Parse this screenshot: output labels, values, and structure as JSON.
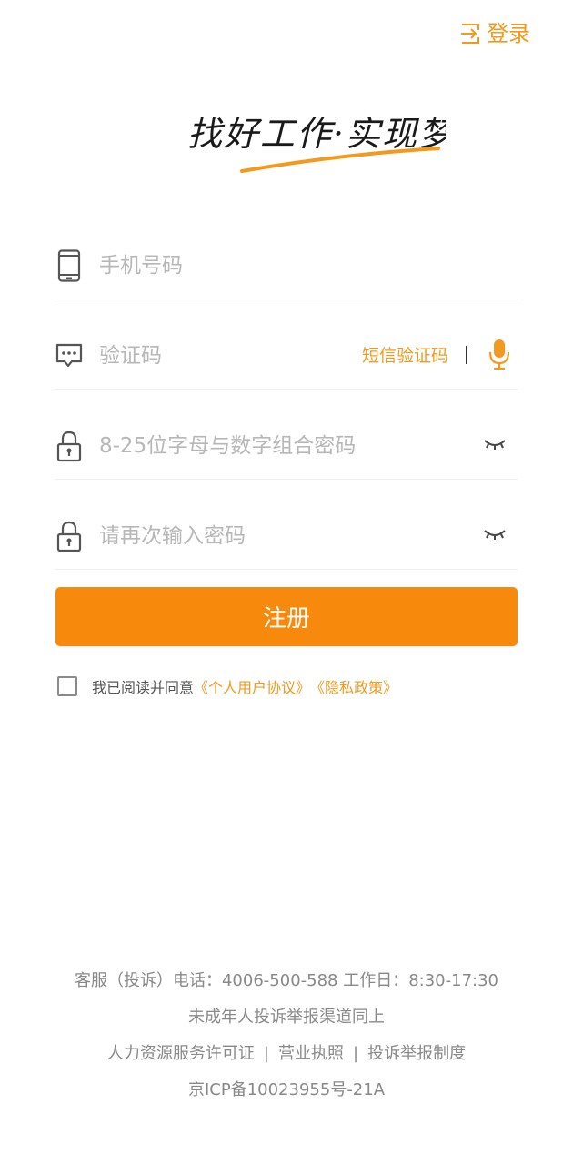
{
  "header": {
    "login_label": "登录"
  },
  "logo": {
    "slogan": "找好工作·实现梦",
    "underline_color": "#f39a1e"
  },
  "form": {
    "phone_placeholder": "手机号码",
    "code_placeholder": "验证码",
    "sms_button": "短信验证码",
    "password_placeholder": "8-25位字母与数字组合密码",
    "confirm_placeholder": "请再次输入密码",
    "register_label": "注册"
  },
  "agreement": {
    "text": "我已阅读并同意",
    "user_agreement": "《个人用户协议》",
    "privacy_policy": "《隐私政策》"
  },
  "footer": {
    "hotline": "客服（投诉）电话：4006-500-588 工作日：8:30-17:30",
    "minor_report": "未成年人投诉举报渠道同上",
    "links": [
      "人力资源服务许可证",
      "营业执照",
      "投诉举报制度"
    ],
    "separator": "|",
    "icp": "京ICP备10023955号-21A"
  },
  "colors": {
    "accent": "#f39a1e",
    "button": "#f7890c",
    "placeholder": "#b7b7b7",
    "footer_text": "#888888"
  },
  "icons": [
    "login-icon",
    "phone-icon",
    "message-icon",
    "lock-icon",
    "mic-icon",
    "eye-closed-icon"
  ]
}
